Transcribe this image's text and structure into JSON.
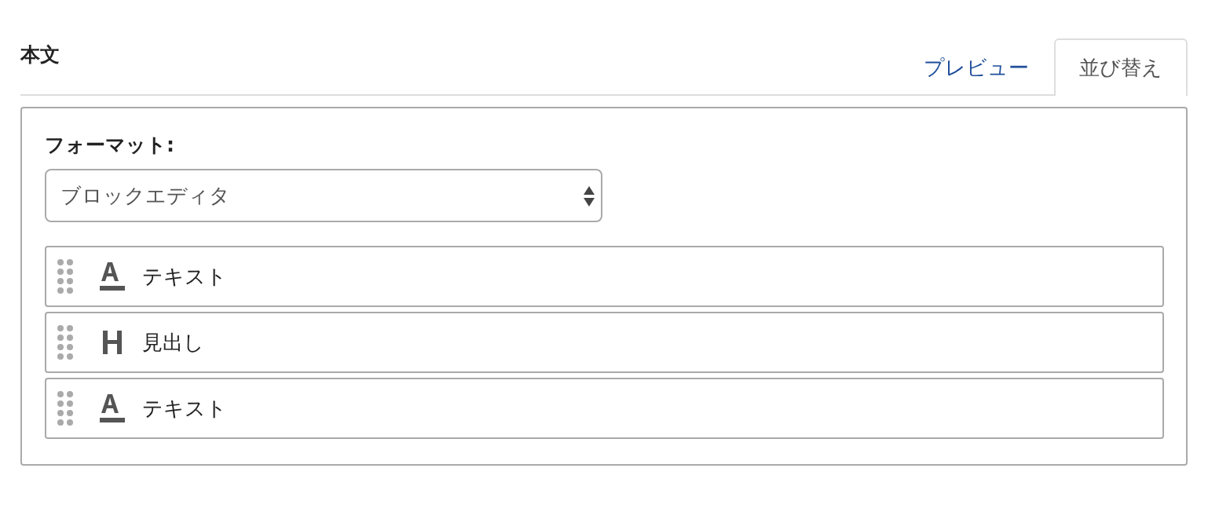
{
  "section": {
    "title": "本文"
  },
  "tabs": [
    {
      "label": "プレビュー",
      "selected": false
    },
    {
      "label": "並び替え",
      "selected": true
    }
  ],
  "format": {
    "label": "フォーマット:",
    "value": "ブロックエディタ"
  },
  "blocks": [
    {
      "kind": "text",
      "label": "テキスト"
    },
    {
      "kind": "heading",
      "label": "見出し"
    },
    {
      "kind": "text",
      "label": "テキスト"
    }
  ]
}
